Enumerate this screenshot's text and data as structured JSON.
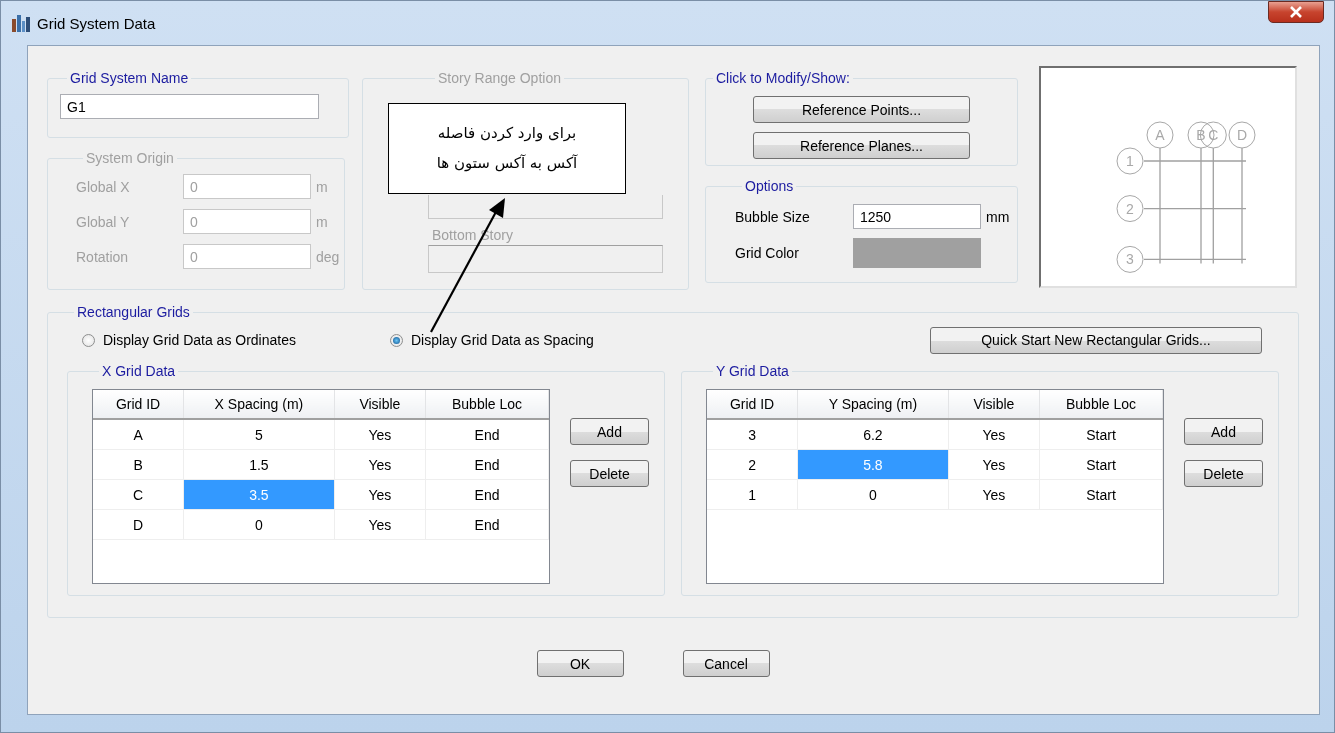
{
  "window": {
    "title": "Grid System Data"
  },
  "grid_system_name": {
    "label": "Grid System Name",
    "value": "G1"
  },
  "system_origin": {
    "label": "System Origin",
    "disabled": true,
    "fields": [
      {
        "label": "Global  X",
        "value": "0",
        "unit": "m"
      },
      {
        "label": "Global  Y",
        "value": "0",
        "unit": "m"
      },
      {
        "label": "Rotation",
        "value": "0",
        "unit": "deg"
      }
    ]
  },
  "story_range": {
    "label": "Story Range Option",
    "disabled": true,
    "bottom_label": "Bottom Story"
  },
  "callout": {
    "text": "برای وارد کردن فاصله\nآکس به آکس ستون ها"
  },
  "modify": {
    "label": "Click to Modify/Show:",
    "buttons": [
      "Reference Points...",
      "Reference Planes..."
    ]
  },
  "options": {
    "label": "Options",
    "bubble_size_label": "Bubble Size",
    "bubble_size": "1250",
    "bubble_size_unit": "mm",
    "grid_color_label": "Grid Color"
  },
  "preview": {
    "x_bubbles": [
      "A",
      "B",
      "C",
      "D"
    ],
    "y_bubbles": [
      "1",
      "2",
      "3"
    ]
  },
  "rectangular_grids": {
    "label": "Rectangular Grids",
    "display_options": [
      {
        "label": "Display Grid Data as Ordinates",
        "selected": false
      },
      {
        "label": "Display Grid Data as Spacing",
        "selected": true
      }
    ],
    "quick_start": "Quick Start New Rectangular Grids...",
    "x_grid": {
      "label": "X Grid Data",
      "columns": [
        "Grid ID",
        "X Spacing  (m)",
        "Visible",
        "Bubble Loc"
      ],
      "rows": [
        {
          "id": "A",
          "spacing": "5",
          "visible": "Yes",
          "bubble_loc": "End",
          "selected": false
        },
        {
          "id": "B",
          "spacing": "1.5",
          "visible": "Yes",
          "bubble_loc": "End",
          "selected": false
        },
        {
          "id": "C",
          "spacing": "3.5",
          "visible": "Yes",
          "bubble_loc": "End",
          "selected": true
        },
        {
          "id": "D",
          "spacing": "0",
          "visible": "Yes",
          "bubble_loc": "End",
          "selected": false
        }
      ],
      "buttons": [
        "Add",
        "Delete"
      ]
    },
    "y_grid": {
      "label": "Y Grid Data",
      "columns": [
        "Grid ID",
        "Y Spacing  (m)",
        "Visible",
        "Bubble Loc"
      ],
      "rows": [
        {
          "id": "3",
          "spacing": "6.2",
          "visible": "Yes",
          "bubble_loc": "Start",
          "selected": false
        },
        {
          "id": "2",
          "spacing": "5.8",
          "visible": "Yes",
          "bubble_loc": "Start",
          "selected": true
        },
        {
          "id": "1",
          "spacing": "0",
          "visible": "Yes",
          "bubble_loc": "Start",
          "selected": false
        }
      ],
      "buttons": [
        "Add",
        "Delete"
      ]
    }
  },
  "buttons": [
    "OK",
    "Cancel"
  ]
}
